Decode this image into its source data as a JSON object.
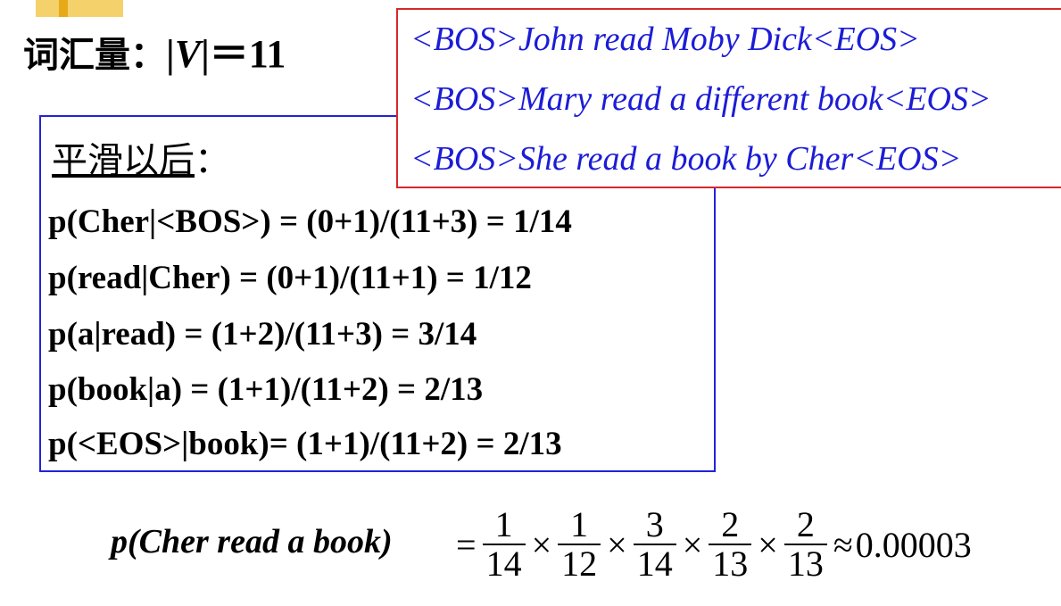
{
  "header": {
    "vocab_label": "词汇量：",
    "vocab_bar1": "|",
    "vocab_v": "V",
    "vocab_bar2": "|",
    "vocab_value": "＝11"
  },
  "corpus": {
    "sentences": [
      "<BOS>John read Moby Dick<EOS>",
      "<BOS>Mary read a different book<EOS>",
      "<BOS>She read a book by Cher<EOS>"
    ]
  },
  "smoothing": {
    "title": "平滑以后",
    "title_colon": "：",
    "equations": [
      "p(Cher|<BOS>) = (0+1)/(11+3) = 1/14",
      "p(read|Cher) = (0+1)/(11+1) = 1/12",
      "p(a|read) = (1+2)/(11+3) = 3/14",
      "p(book|a) = (1+1)/(11+2) = 2/13",
      "p(<EOS>|book)= (1+1)/(11+2) = 2/13"
    ]
  },
  "result": {
    "lhs": "p(Cher read a book)",
    "equals": "=",
    "fractions": [
      {
        "num": "1",
        "den": "14"
      },
      {
        "num": "1",
        "den": "12"
      },
      {
        "num": "3",
        "den": "14"
      },
      {
        "num": "2",
        "den": "13"
      },
      {
        "num": "2",
        "den": "13"
      }
    ],
    "times": "×",
    "approx": "≈",
    "value": "0.00003"
  },
  "colors": {
    "accent_square": "#f5d16b",
    "accent_bar": "#e7a91a",
    "box_blue": "#2323d8",
    "box_red": "#d42a2a",
    "sentence_text": "#1c1cd6"
  }
}
